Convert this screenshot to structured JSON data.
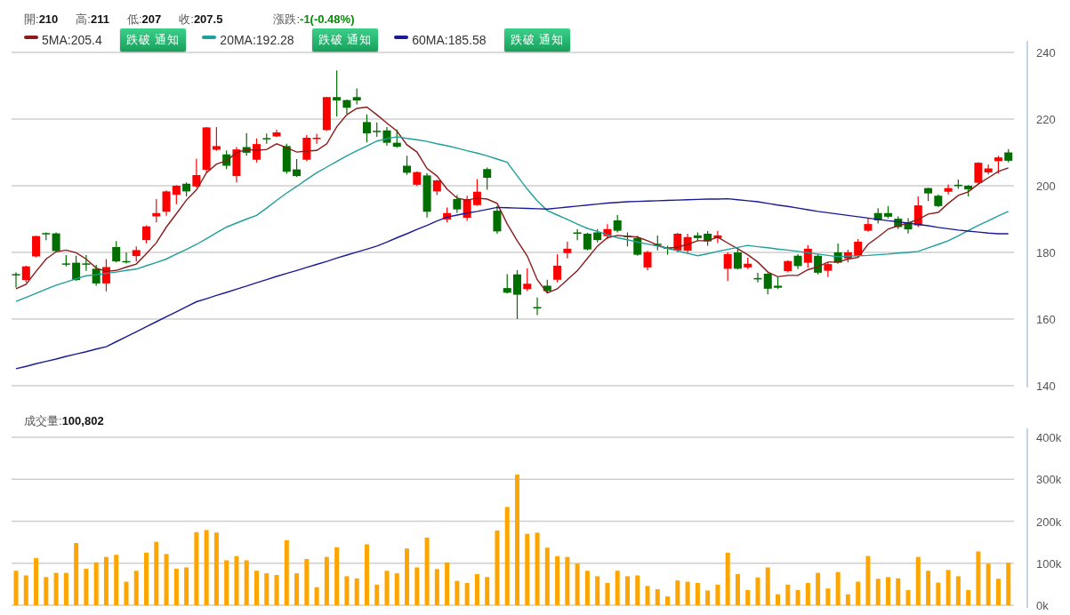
{
  "quote": [
    {
      "kind": "plain",
      "text": "開:**210**"
    },
    {
      "kind": "plain",
      "text": "高:**211**"
    },
    {
      "kind": "plain",
      "text": "低:**207**"
    },
    {
      "kind": "plain",
      "text": "收:**207.5**"
    },
    {
      "kind": "change",
      "text": "漲跌:**-1(-0.48%)**"
    }
  ],
  "legends": [
    {
      "label": "5MA:205.4",
      "color": "#8b1a1a",
      "button": "跌破 通知"
    },
    {
      "label": "20MA:192.28",
      "color": "#1f9e9a",
      "button": "跌破 通知"
    },
    {
      "label": "60MA:185.58",
      "color": "#1a1a96",
      "button": "跌破 通知"
    }
  ],
  "price_chart": {
    "chart_data": {
      "type": "candlestick",
      "ylim": [
        140,
        240
      ],
      "yticks": [
        140,
        160,
        180,
        200,
        220,
        240
      ],
      "grid": true,
      "ohlc": [
        [
          173.5,
          174,
          169.5,
          173.2
        ],
        [
          171.7,
          176,
          171,
          175.8
        ],
        [
          178.8,
          185,
          178.5,
          184.9
        ],
        [
          185.8,
          186,
          183.7,
          185.5
        ],
        [
          185.7,
          186,
          180,
          180.4
        ],
        [
          176.7,
          179.2,
          175.8,
          176.3
        ],
        [
          176.9,
          179,
          171.5,
          171.7
        ],
        [
          176.7,
          179.2,
          174.5,
          176.3
        ],
        [
          175.1,
          176.3,
          170,
          170.7
        ],
        [
          170.7,
          178,
          168.3,
          175.6
        ],
        [
          181.6,
          183.4,
          177,
          177.3
        ],
        [
          177.4,
          180,
          176.7,
          177.2
        ],
        [
          178.9,
          181.8,
          177.3,
          180.7
        ],
        [
          183.7,
          188.1,
          182.7,
          187.8
        ],
        [
          190.8,
          196,
          189,
          191.8
        ],
        [
          192.2,
          198.6,
          191,
          198.3
        ],
        [
          197.3,
          200.2,
          194.5,
          200.0
        ],
        [
          200.6,
          201,
          196.8,
          198.3
        ],
        [
          199.8,
          208.1,
          199.5,
          203.2
        ],
        [
          204.8,
          217.6,
          204,
          217.5
        ],
        [
          210.8,
          217.6,
          210.5,
          211.9
        ],
        [
          209.4,
          210.6,
          205,
          206.0
        ],
        [
          202.9,
          211.6,
          201,
          210.9
        ],
        [
          211.6,
          215.8,
          209,
          209.9
        ],
        [
          207.8,
          214.2,
          207,
          212.5
        ],
        [
          214.3,
          215.7,
          212.6,
          214.0
        ],
        [
          214.8,
          216.8,
          214.6,
          216.0
        ],
        [
          211.9,
          212.6,
          203.6,
          204.2
        ],
        [
          204.9,
          208,
          202.6,
          202.9
        ],
        [
          207.8,
          215.2,
          207.4,
          214.4
        ],
        [
          214.0,
          215.6,
          212.6,
          214.4
        ],
        [
          216.7,
          226.7,
          216.5,
          226.6
        ],
        [
          226.6,
          234.6,
          220.8,
          225.6
        ],
        [
          225.7,
          225.9,
          221.6,
          223.4
        ],
        [
          226.6,
          229.2,
          224.4,
          225.6
        ],
        [
          219.1,
          221.4,
          213,
          215.7
        ],
        [
          216.5,
          219,
          214.7,
          216.3
        ],
        [
          216.6,
          217.6,
          212,
          212.9
        ],
        [
          212.9,
          216.9,
          211.4,
          211.7
        ],
        [
          206.0,
          209,
          203.3,
          203.9
        ],
        [
          200.3,
          204.3,
          200,
          204.1
        ],
        [
          203.1,
          203.8,
          190.5,
          192.2
        ],
        [
          198.3,
          201.8,
          197.2,
          201.6
        ],
        [
          189.9,
          193.5,
          189,
          191.8
        ],
        [
          196.0,
          197.2,
          191.9,
          192.9
        ],
        [
          190.4,
          197,
          189.5,
          196.0
        ],
        [
          194.2,
          202,
          194,
          198.2
        ],
        [
          205.0,
          205.5,
          198.8,
          202.4
        ],
        [
          192.5,
          194,
          185.6,
          186.3
        ],
        [
          169.3,
          173.5,
          167.7,
          167.9
        ],
        [
          173.4,
          174.7,
          160,
          167.3
        ],
        [
          169.0,
          175.2,
          168.4,
          170.6
        ],
        [
          163.6,
          166.5,
          161.2,
          163.4
        ],
        [
          170.0,
          171.8,
          168,
          168.4
        ],
        [
          171.8,
          179.4,
          171,
          176.0
        ],
        [
          179.8,
          183.2,
          178.2,
          181.1
        ],
        [
          186.0,
          187,
          183.7,
          185.7
        ],
        [
          185.6,
          185.9,
          180.6,
          180.9
        ],
        [
          186.0,
          187,
          183,
          183.7
        ],
        [
          184.9,
          188.5,
          184,
          187.0
        ],
        [
          189.6,
          191.2,
          186,
          186.5
        ],
        [
          185.0,
          186,
          181.8,
          184.7
        ],
        [
          184.3,
          185,
          179,
          179.3
        ],
        [
          175.5,
          180.5,
          174.6,
          180.1
        ],
        [
          182.6,
          185.1,
          180.6,
          182.3
        ],
        [
          181.5,
          182,
          179.3,
          181.3
        ],
        [
          180.6,
          185.9,
          180,
          185.6
        ],
        [
          180.5,
          185.6,
          179.7,
          184.6
        ],
        [
          185.1,
          186,
          183.4,
          184.3
        ],
        [
          185.6,
          186.4,
          182,
          183.3
        ],
        [
          184.3,
          186.5,
          182.8,
          185.1
        ],
        [
          175.1,
          180,
          171.4,
          179.5
        ],
        [
          180.0,
          180.9,
          174.9,
          175.1
        ],
        [
          175.5,
          178.4,
          175,
          176.6
        ],
        [
          172.3,
          173.9,
          171,
          172.1
        ],
        [
          173.6,
          173.8,
          167.4,
          169.1
        ],
        [
          170.0,
          172.6,
          169,
          169.4
        ],
        [
          174.4,
          177.6,
          174,
          177.4
        ],
        [
          179.0,
          179.5,
          175,
          175.9
        ],
        [
          176.9,
          182.2,
          175.5,
          181.1
        ],
        [
          179.0,
          179.5,
          173.4,
          173.9
        ],
        [
          174.5,
          177,
          172.6,
          176.5
        ],
        [
          180.0,
          182.7,
          176.6,
          176.9
        ],
        [
          178.2,
          180.8,
          177,
          180.0
        ],
        [
          178.9,
          184,
          178.4,
          183.2
        ],
        [
          186.5,
          190.4,
          186.2,
          188.5
        ],
        [
          191.8,
          193.3,
          188.7,
          189.6
        ],
        [
          191.8,
          193.9,
          190.2,
          190.7
        ],
        [
          190.1,
          190.8,
          187,
          187.6
        ],
        [
          189.0,
          190.3,
          185.7,
          186.9
        ],
        [
          188.1,
          196.8,
          187.7,
          194.1
        ],
        [
          199.3,
          199.4,
          195.4,
          197.7
        ],
        [
          197.0,
          197.4,
          193.6,
          193.9
        ],
        [
          198.2,
          200.4,
          197.4,
          199.3
        ],
        [
          200.3,
          201.9,
          199.1,
          200.1
        ],
        [
          200.0,
          200.2,
          196.8,
          198.9
        ],
        [
          200.9,
          207.1,
          200.6,
          206.9
        ],
        [
          204.0,
          206.4,
          203.4,
          205.2
        ],
        [
          207.4,
          209,
          203.7,
          208.5
        ],
        [
          210,
          211,
          207,
          207.5
        ]
      ],
      "series": [
        {
          "type": "line",
          "color": "#8b1a1a",
          "values": [
            169.1,
            170.4,
            174.3,
            178.0,
            180.2,
            180.7,
            179.9,
            178.0,
            175.3,
            174.3,
            174.6,
            175.6,
            176.5,
            179.6,
            182.9,
            187.6,
            191.6,
            195.7,
            198.8,
            203.9,
            206.5,
            207.5,
            209.9,
            210.9,
            210.6,
            210.9,
            212.6,
            211.4,
            210.1,
            210.4,
            210.6,
            212.6,
            217.7,
            221.3,
            223.2,
            223.6,
            221.3,
            218.8,
            216.4,
            212.3,
            210.1,
            205.2,
            202.9,
            199.0,
            196.3,
            195.7,
            196.3,
            196.0,
            194.7,
            188.6,
            183.5,
            178.9,
            171.8,
            167.8,
            169.1,
            171.8,
            174.5,
            178.2,
            181.9,
            184.4,
            185.1,
            184.8,
            184.6,
            183.5,
            182.2,
            181.2,
            181.6,
            182.4,
            183.5,
            183.5,
            184.6,
            182.8,
            181.1,
            179.3,
            177.1,
            174.1,
            172.7,
            173.1,
            173.1,
            174.8,
            175.7,
            177.1,
            177.1,
            178.0,
            178.5,
            182.4,
            184.6,
            187.0,
            188.0,
            188.8,
            189.9,
            191.5,
            192.0,
            194.7,
            197.1,
            198.2,
            200.5,
            202.4,
            204.3,
            205.4
          ]
        },
        {
          "type": "line",
          "color": "#1f9e9a",
          "values": [
            165.3,
            166.5,
            167.7,
            169.0,
            170.2,
            171.1,
            172.1,
            173.0,
            173.3,
            173.7,
            174.1,
            174.6,
            175.0,
            176.0,
            177.0,
            178.0,
            179.5,
            180.9,
            182.4,
            184.1,
            185.9,
            187.6,
            188.8,
            190.0,
            191.1,
            193.3,
            195.6,
            197.8,
            199.8,
            201.9,
            203.9,
            205.6,
            207.3,
            209.0,
            210.5,
            211.9,
            213.4,
            214.1,
            214.7,
            214.2,
            213.8,
            213.3,
            212.6,
            212.0,
            211.3,
            210.5,
            209.8,
            209.0,
            208.0,
            207.0,
            203.0,
            199.0,
            195.5,
            192.6,
            191.2,
            189.9,
            188.5,
            187.2,
            186.3,
            185.3,
            184.4,
            183.8,
            183.1,
            182.5,
            181.9,
            181.2,
            180.5,
            179.7,
            179.0,
            179.6,
            180.3,
            180.9,
            181.5,
            182.1,
            181.7,
            181.4,
            181.0,
            180.7,
            180.3,
            179.9,
            179.5,
            179.1,
            178.7,
            178.9,
            179.0,
            179.1,
            179.3,
            179.5,
            179.8,
            180.0,
            180.3,
            181.4,
            182.4,
            183.5,
            185.0,
            186.6,
            188.1,
            189.5,
            191.0,
            192.3
          ]
        },
        {
          "type": "line",
          "color": "#1a1a96",
          "values": [
            145.1,
            145.8,
            146.6,
            147.3,
            148.0,
            148.8,
            149.5,
            150.2,
            151.0,
            151.7,
            153.2,
            154.7,
            156.2,
            157.7,
            159.2,
            160.7,
            162.2,
            163.7,
            165.2,
            166.1,
            167.1,
            168.0,
            169.0,
            169.9,
            170.9,
            171.8,
            172.8,
            173.7,
            174.6,
            175.5,
            176.4,
            177.3,
            178.3,
            179.2,
            180.1,
            181.0,
            181.9,
            183.1,
            184.4,
            185.6,
            186.9,
            188.1,
            189.4,
            190.6,
            191.2,
            191.8,
            192.3,
            192.9,
            193.5,
            193.4,
            193.3,
            193.2,
            193.1,
            193.0,
            193.3,
            193.6,
            193.9,
            194.2,
            194.5,
            194.8,
            195.0,
            195.2,
            195.3,
            195.4,
            195.5,
            195.6,
            195.7,
            195.8,
            195.9,
            196.0,
            196.0,
            196.1,
            195.8,
            195.5,
            195.2,
            194.7,
            194.2,
            193.8,
            193.3,
            192.8,
            192.3,
            191.9,
            191.5,
            191.1,
            190.7,
            190.3,
            189.9,
            189.5,
            189.2,
            188.8,
            188.4,
            188.0,
            187.5,
            187.1,
            186.7,
            186.4,
            186.1,
            185.8,
            185.6,
            185.6
          ]
        }
      ]
    }
  },
  "volume": {
    "label": "成交量:**100,802**",
    "chart_data": {
      "type": "bar",
      "ylim": [
        0,
        400
      ],
      "grid": true,
      "yticks": [
        {
          "value": 0,
          "label": "0k"
        },
        {
          "value": 100,
          "label": "100k"
        },
        {
          "value": 200,
          "label": "200k"
        },
        {
          "value": 300,
          "label": "300k"
        },
        {
          "value": 400,
          "label": "400k"
        }
      ],
      "series": [
        {
          "color": "#ffa500",
          "values": [
            82,
            71,
            112,
            67,
            77,
            77,
            148,
            87,
            102,
            115,
            120,
            56,
            82,
            125,
            151,
            122,
            87,
            90,
            174,
            179,
            173,
            107,
            117,
            107,
            82,
            76,
            72,
            155,
            76,
            110,
            43,
            115,
            138,
            69,
            64,
            145,
            49,
            82,
            76,
            135,
            90,
            161,
            86,
            102,
            58,
            53,
            74,
            67,
            178,
            234,
            311,
            170,
            173,
            137,
            117,
            115,
            99,
            82,
            69,
            53,
            82,
            69,
            71,
            46,
            38,
            21,
            59,
            56,
            53,
            35,
            49,
            125,
            74,
            36,
            66,
            90,
            26,
            49,
            36,
            53,
            77,
            40,
            79,
            26,
            56,
            117,
            63,
            67,
            64,
            36,
            115,
            82,
            54,
            84,
            69,
            36,
            128,
            99,
            63,
            101
          ]
        }
      ]
    }
  }
}
